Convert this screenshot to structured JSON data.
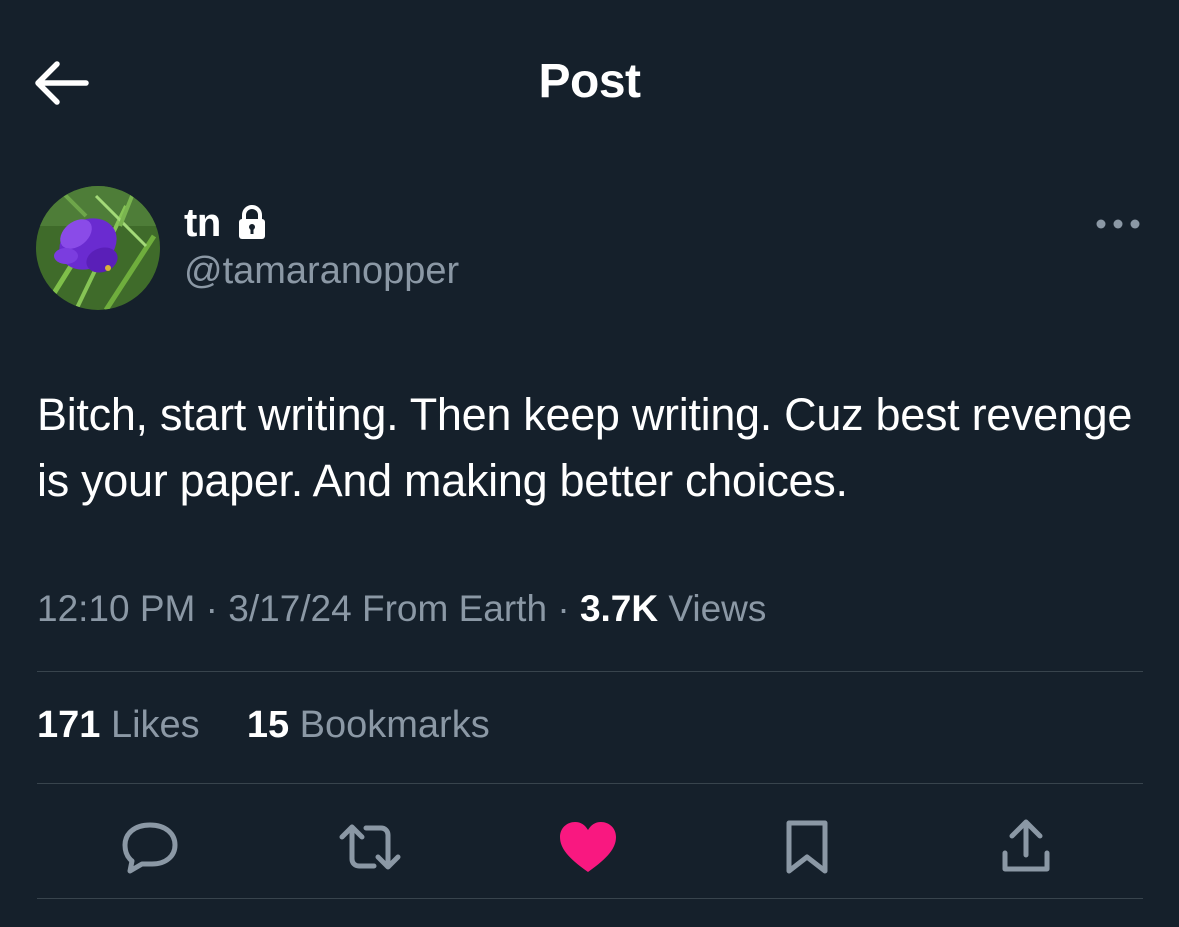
{
  "header": {
    "title": "Post",
    "back_icon": "arrow-left-icon"
  },
  "author": {
    "display_name": "tn",
    "handle": "@tamaranopper",
    "protected_icon": "lock-icon",
    "avatar": "purple-flower-avatar"
  },
  "post": {
    "text": "Bitch, start writing. Then keep writing. Cuz best revenge is your paper. And making better choices."
  },
  "meta": {
    "time": "12:10 PM",
    "sep1": " · ",
    "date": "3/17/24",
    "source": " From Earth",
    "sep2": " · ",
    "views_count": "3.7K",
    "views_label": " Views"
  },
  "stats": {
    "likes_count": "171",
    "likes_label": " Likes",
    "bookmarks_count": "15",
    "bookmarks_label": " Bookmarks"
  },
  "actions": {
    "icons": [
      "reply-icon",
      "repost-icon",
      "heart-icon",
      "bookmark-icon",
      "share-icon"
    ],
    "liked": true
  },
  "colors": {
    "background": "#15202b",
    "text_primary": "#ffffff",
    "text_secondary": "#8b98a5",
    "divider": "#38444d",
    "like_pink": "#f91880"
  }
}
